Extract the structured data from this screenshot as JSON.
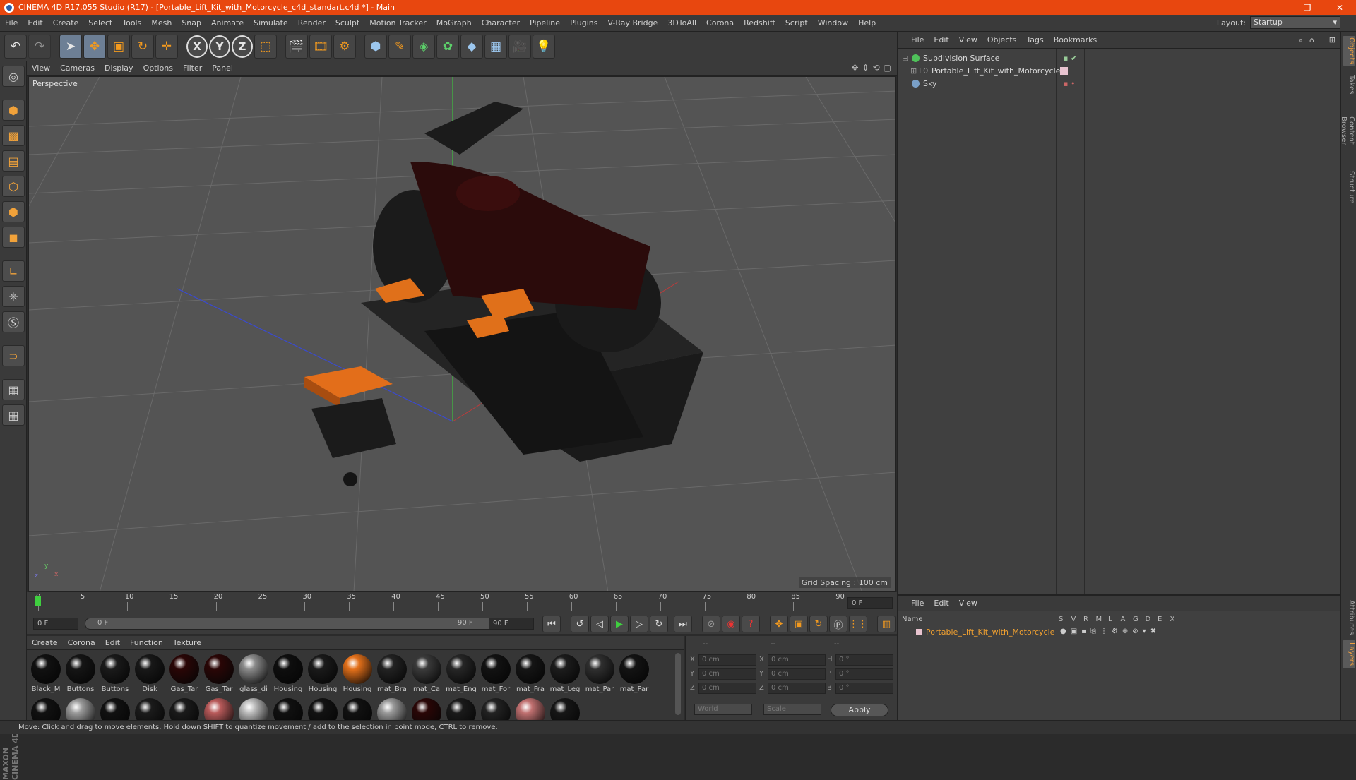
{
  "window": {
    "title": "CINEMA 4D R17.055 Studio (R17) - [Portable_Lift_Kit_with_Motorcycle_c4d_standart.c4d *] - Main",
    "minimize": "—",
    "maximize": "❐",
    "close": "✕"
  },
  "menu": {
    "items": [
      "File",
      "Edit",
      "Create",
      "Select",
      "Tools",
      "Mesh",
      "Snap",
      "Animate",
      "Simulate",
      "Render",
      "Sculpt",
      "Motion Tracker",
      "MoGraph",
      "Character",
      "Pipeline",
      "Plugins",
      "V-Ray Bridge",
      "3DToAll",
      "Corona",
      "Redshift",
      "Script",
      "Window",
      "Help"
    ],
    "layout_label": "Layout:",
    "layout_value": "Startup"
  },
  "toolbar": {
    "undo": "↶",
    "redo": "↷",
    "axis_x": "X",
    "axis_y": "Y",
    "axis_z": "Z"
  },
  "viewport": {
    "menu": [
      "View",
      "Cameras",
      "Display",
      "Options",
      "Filter",
      "Panel"
    ],
    "label": "Perspective",
    "grid_spacing": "Grid Spacing : 100 cm"
  },
  "timeline": {
    "ticks": [
      "0",
      "5",
      "10",
      "15",
      "20",
      "25",
      "30",
      "35",
      "40",
      "45",
      "50",
      "55",
      "60",
      "65",
      "70",
      "75",
      "80",
      "85",
      "90"
    ],
    "current_frame": "0 F",
    "start_frame": "0 F",
    "range_start": "0 F",
    "range_end": "90 F",
    "end_frame": "90 F"
  },
  "materials": {
    "menu": [
      "Create",
      "Corona",
      "Edit",
      "Function",
      "Texture"
    ],
    "row1": [
      {
        "name": "Black_M",
        "color": "#111111"
      },
      {
        "name": "Buttons",
        "color": "#151515"
      },
      {
        "name": "Buttons",
        "color": "#1a1a1a"
      },
      {
        "name": "Disk",
        "color": "#181818"
      },
      {
        "name": "Gas_Tar",
        "color": "#2a0606"
      },
      {
        "name": "Gas_Tar",
        "color": "#2a0606"
      },
      {
        "name": "glass_di",
        "color": "#8a8a8a"
      },
      {
        "name": "Housing",
        "color": "#0e0e0e"
      },
      {
        "name": "Housing",
        "color": "#1a1a1a"
      },
      {
        "name": "Housing",
        "color": "#e3701a"
      },
      {
        "name": "mat_Bra",
        "color": "#222222"
      },
      {
        "name": "mat_Ca",
        "color": "#3a3a3a"
      },
      {
        "name": "mat_Eng",
        "color": "#262626"
      },
      {
        "name": "mat_For",
        "color": "#121212"
      },
      {
        "name": "mat_Fra",
        "color": "#151515"
      },
      {
        "name": "mat_Leg",
        "color": "#1c1c1c"
      },
      {
        "name": "mat_Par",
        "color": "#2f2f2f"
      },
      {
        "name": "mat_Par",
        "color": "#131313"
      }
    ],
    "row2_colors": [
      "#111111",
      "#9a9a9a",
      "#111111",
      "#1b1b1b",
      "#1a1a1a",
      "#b85a5a",
      "#bbbbbb",
      "#101010",
      "#121212",
      "#111111",
      "#999999",
      "#2a0606",
      "#1a1a1a",
      "#222222",
      "#c07070",
      "#161616"
    ]
  },
  "coords": {
    "headers": [
      "--",
      "--",
      "--"
    ],
    "rows": [
      {
        "a": "X",
        "av": "0 cm",
        "b": "X",
        "bv": "0 cm",
        "c": "H",
        "cv": "0 °"
      },
      {
        "a": "Y",
        "av": "0 cm",
        "b": "Y",
        "bv": "0 cm",
        "c": "P",
        "cv": "0 °"
      },
      {
        "a": "Z",
        "av": "0 cm",
        "b": "Z",
        "bv": "0 cm",
        "c": "B",
        "cv": "0 °"
      }
    ],
    "world": "World",
    "scale": "Scale",
    "apply": "Apply"
  },
  "objects": {
    "menu": [
      "File",
      "Edit",
      "View",
      "Objects",
      "Tags",
      "Bookmarks"
    ],
    "items": [
      {
        "name": "Subdivision Surface",
        "color": "#4fc25a"
      },
      {
        "name": "Portable_Lift_Kit_with_Motorcycle",
        "color": "#bdbdbd"
      },
      {
        "name": "Sky",
        "color": "#7aa0c8"
      }
    ]
  },
  "layers": {
    "menu": [
      "File",
      "Edit",
      "View"
    ],
    "col_name": "Name",
    "cols": [
      "S",
      "V",
      "R",
      "M",
      "L",
      "A",
      "G",
      "D",
      "E",
      "X"
    ],
    "item": "Portable_Lift_Kit_with_Motorcycle"
  },
  "righttabs": [
    "Objects",
    "Takes",
    "Content Browser",
    "Structure"
  ],
  "righttabs_bottom": [
    "Attributes",
    "Layers"
  ],
  "brand": "MAXON CINEMA 4D",
  "status": "Move: Click and drag to move elements. Hold down SHIFT to quantize movement / add to the selection in point mode, CTRL to remove."
}
